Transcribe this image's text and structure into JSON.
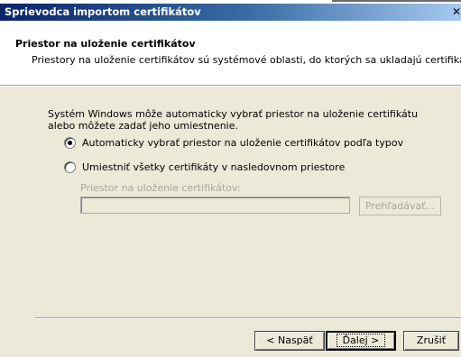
{
  "window": {
    "title": "Sprievodca importom certifikátov"
  },
  "header": {
    "title": "Priestor na uloženie certifikátov",
    "subtitle": "Priestory na uloženie certifikátov sú systémové oblasti, do ktorých sa ukladajú certifikáty."
  },
  "body": {
    "description": "Systém Windows môže automaticky vybrať priestor na uloženie certifikátu alebo môžete zadať jeho umiestnenie.",
    "options": [
      {
        "label": "Automaticky vybrať priestor na uloženie certifikátov podľa typov",
        "selected": true
      },
      {
        "label": "Umiestniť všetky certifikáty v nasledovnom priestore",
        "selected": false
      }
    ],
    "store_label": "Priestor na uloženie certifikátov:",
    "store_value": "",
    "browse_label": "Prehľadávať..."
  },
  "footer": {
    "back_label": "< Naspäť",
    "next_label": "Ďalej >",
    "cancel_label": "Zrušiť"
  }
}
